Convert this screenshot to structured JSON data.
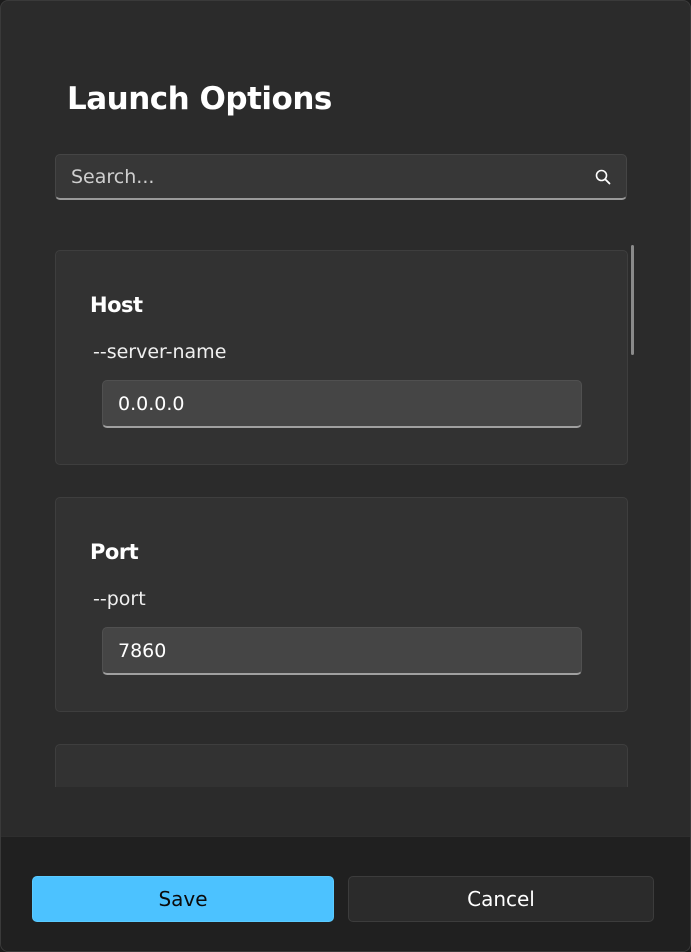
{
  "dialog": {
    "title": "Launch Options"
  },
  "search": {
    "placeholder": "Search...",
    "icon": "search-icon"
  },
  "options": [
    {
      "title": "Host",
      "flag": "--server-name",
      "value": "0.0.0.0"
    },
    {
      "title": "Port",
      "flag": "--port",
      "value": "7860"
    }
  ],
  "footer": {
    "save_label": "Save",
    "cancel_label": "Cancel"
  },
  "colors": {
    "accent": "#4cc2ff",
    "dialog_bg": "#2b2b2b",
    "card_bg": "#323232",
    "footer_bg": "#202020"
  }
}
